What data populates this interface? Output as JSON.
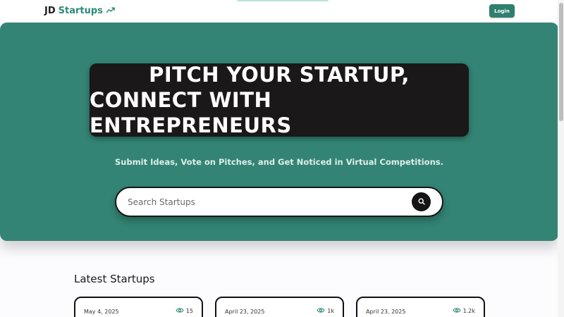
{
  "brand": {
    "prefix": "JD",
    "name": "Startups",
    "accent_color": "#2e8a78",
    "icon": "trending-up-icon"
  },
  "nav": {
    "login_label": "Login"
  },
  "hero": {
    "headline_line1": "PITCH YOUR STARTUP,",
    "headline_line2": "CONNECT WITH ENTREPRENEURS",
    "subtitle": "Submit Ideas, Vote on Pitches, and Get Noticed in Virtual Competitions.",
    "background_color": "#338474"
  },
  "search": {
    "placeholder": "Search Startups",
    "button_icon": "search-icon"
  },
  "latest": {
    "title": "Latest Startups",
    "cards": [
      {
        "date": "May 4, 2025",
        "views": "15"
      },
      {
        "date": "April 23, 2025",
        "views": "1k"
      },
      {
        "date": "April 23, 2025",
        "views": "1.2k"
      }
    ]
  }
}
